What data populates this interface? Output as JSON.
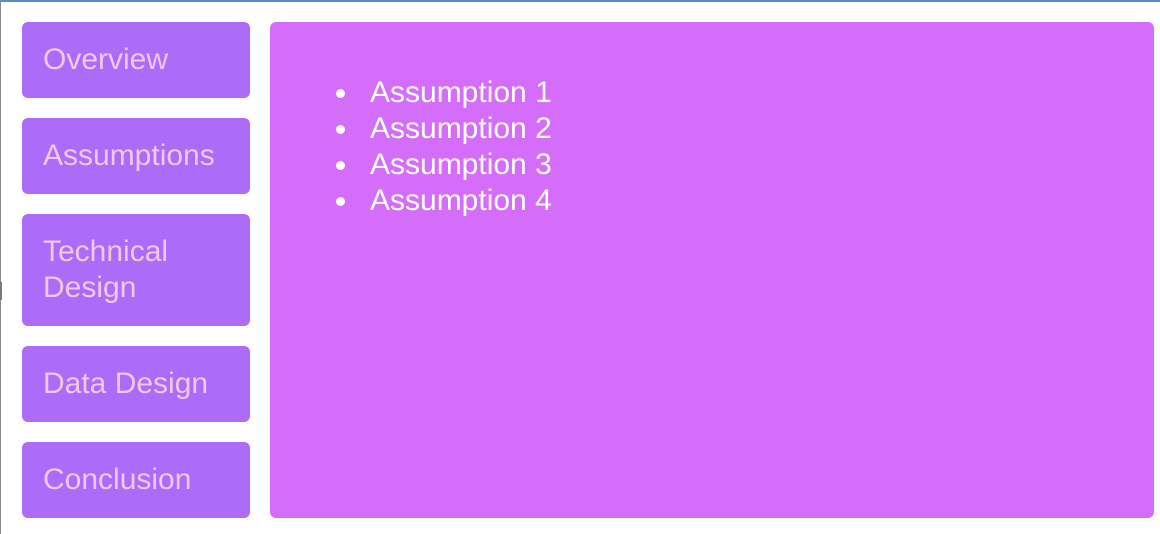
{
  "nav": {
    "items": [
      {
        "label": "Overview"
      },
      {
        "label": "Assumptions"
      },
      {
        "label": "Technical Design"
      },
      {
        "label": "Data Design"
      },
      {
        "label": "Conclusion"
      }
    ]
  },
  "content": {
    "list": [
      "Assumption 1",
      "Assumption 2",
      "Assumption 3",
      "Assumption 4"
    ]
  },
  "colors": {
    "nav_bg": "#ad6bfa",
    "nav_text": "#f3c6e6",
    "content_bg": "#d56dfb",
    "content_text": "#ffffff"
  }
}
